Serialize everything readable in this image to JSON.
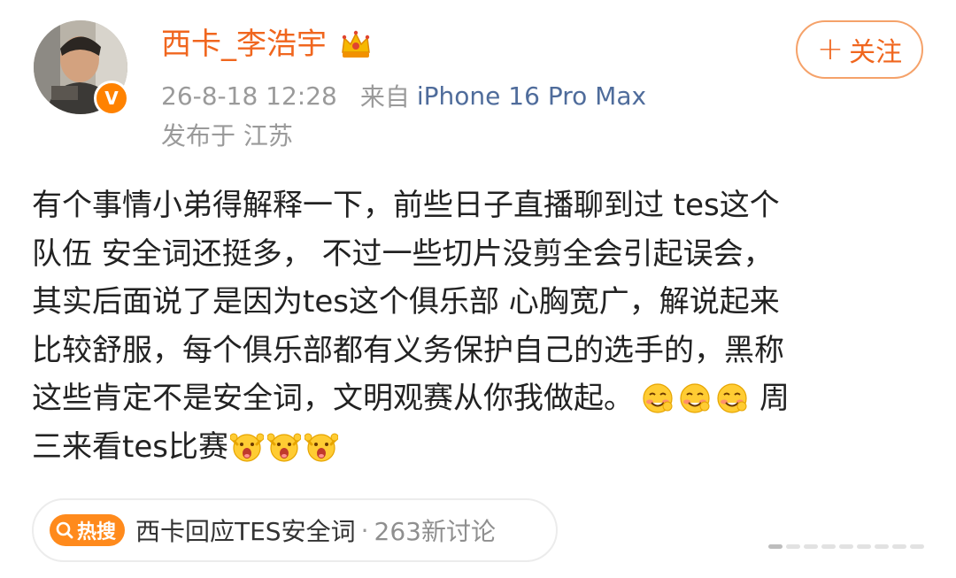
{
  "user": {
    "name": "西卡_李浩宇",
    "verified_mark": "V",
    "follow_label": "关注",
    "follow_plus": "+"
  },
  "meta": {
    "time": "26-8-18 12:28",
    "from_label": "来自",
    "device": "iPhone 16 Pro Max",
    "location": "发布于 江苏"
  },
  "post": {
    "lines": [
      "有个事情小弟得解释一下，前些日子直播聊到过 tes这个",
      "队伍 安全词还挺多，  不过一些切片没剪全会引起误会，",
      "其实后面说了是因为tes这个俱乐部 心胸宽广，解说起来",
      "比较舒服，每个俱乐部都有义务保护自己的选手的，黑称",
      "这些肯定不是安全词，文明观赛从你我做起。",
      "周",
      "三来看tes比赛"
    ],
    "emojis": {
      "line5": [
        "shy-grin-emoji",
        "shy-grin-emoji",
        "shy-grin-emoji"
      ],
      "line6": [
        "cheering-emoji",
        "cheering-emoji",
        "cheering-emoji"
      ]
    }
  },
  "topic": {
    "badge": "热搜",
    "title": "西卡回应TES安全词",
    "separator": "·",
    "count": "263新讨论"
  },
  "colors": {
    "username": "#f0661e",
    "link": "#4f6c9b",
    "meta": "#9a9a9a",
    "badge_orange": "#ff8200",
    "hot_orange": "#ff8a1c"
  }
}
